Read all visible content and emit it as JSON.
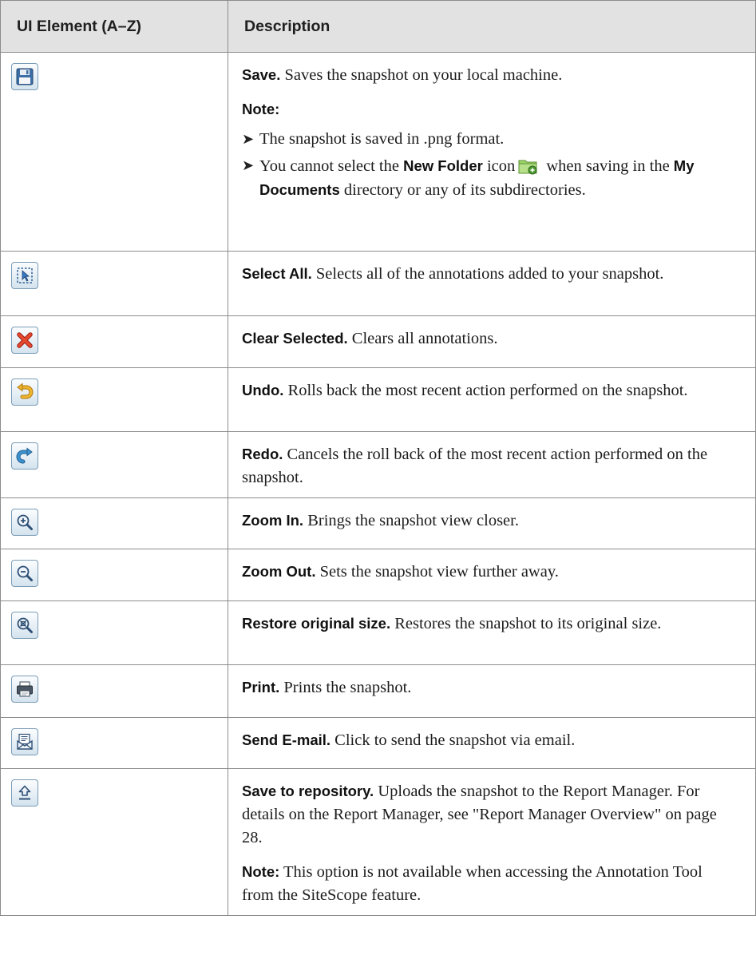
{
  "table": {
    "headers": {
      "element": "UI Element (A–Z)",
      "description": "Description"
    },
    "rows": [
      {
        "icon": "save-icon",
        "title": "Save.",
        "text": " Saves the snapshot on your local machine.",
        "note_label": "Note:",
        "bullet1": "The snapshot is saved in .png format.",
        "bullet2_pre": "You cannot select the ",
        "bullet2_b1": "New Folder",
        "bullet2_mid": " icon",
        "bullet2_post1": " when saving in the ",
        "bullet2_b2": "My Documents",
        "bullet2_post2": " directory or any of its subdirectories."
      },
      {
        "icon": "select-all-icon",
        "title": "Select All.",
        "text": " Selects all of the annotations added to your snapshot."
      },
      {
        "icon": "clear-selected-icon",
        "title": "Clear Selected.",
        "text": " Clears all annotations."
      },
      {
        "icon": "undo-icon",
        "title": "Undo.",
        "text": " Rolls back the most recent action performed on the snapshot."
      },
      {
        "icon": "redo-icon",
        "title": "Redo.",
        "text": " Cancels the roll back of the most recent action performed on the snapshot."
      },
      {
        "icon": "zoom-in-icon",
        "title": "Zoom In.",
        "text": " Brings the snapshot view closer."
      },
      {
        "icon": "zoom-out-icon",
        "title": "Zoom Out.",
        "text": " Sets the snapshot view further away."
      },
      {
        "icon": "restore-size-icon",
        "title": "Restore original size.",
        "text": " Restores the snapshot to its original size."
      },
      {
        "icon": "print-icon",
        "title": "Print.",
        "text": " Prints the snapshot."
      },
      {
        "icon": "send-email-icon",
        "title": "Send E-mail.",
        "text": " Click to send the snapshot via email."
      },
      {
        "icon": "save-to-repository-icon",
        "title": "Save to repository.",
        "text": " Uploads the snapshot to the Report Manager. For details on the Report Manager, see \"Report Manager Overview\" on page 28.",
        "note_label": "Note:",
        "note_text": " This option is not available when accessing the Annotation Tool from the SiteScope feature."
      }
    ]
  }
}
